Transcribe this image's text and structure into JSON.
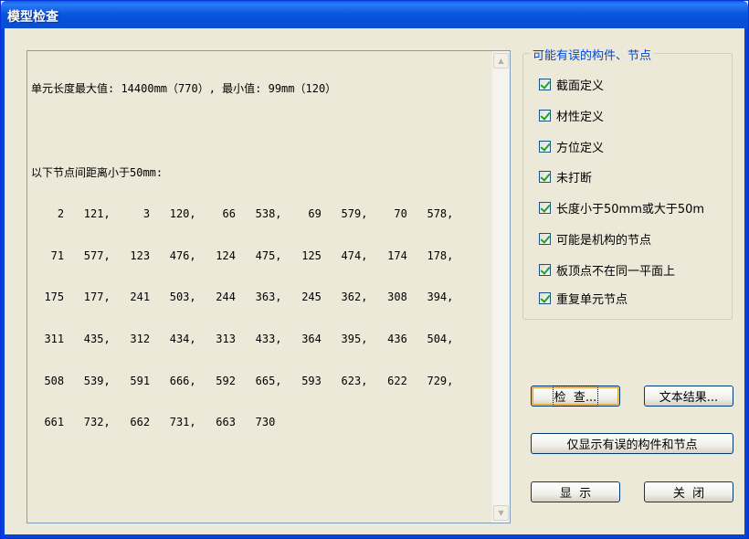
{
  "window": {
    "title": "模型检查"
  },
  "output": {
    "lines": [
      "单元长度最大值: 14400mm（770）, 最小值: 99mm（120）",
      "",
      "以下节点间距离小于50mm:",
      "    2   121,     3   120,    66   538,    69   579,    70   578,",
      "   71   577,   123   476,   124   475,   125   474,   174   178,",
      "  175   177,   241   503,   244   363,   245   362,   308   394,",
      "  311   435,   312   434,   313   433,   364   395,   436   504,",
      "  508   539,   591   666,   592   665,   593   623,   622   729,",
      "  661   732,   662   731,   663   730"
    ]
  },
  "checks": {
    "group_title": "可能有误的构件、节点",
    "items": [
      {
        "label": "截面定义",
        "checked": true
      },
      {
        "label": "材性定义",
        "checked": true
      },
      {
        "label": "方位定义",
        "checked": true
      },
      {
        "label": "未打断",
        "checked": true
      },
      {
        "label": "长度小于50mm或大于50m",
        "checked": true
      },
      {
        "label": "可能是机构的节点",
        "checked": true
      },
      {
        "label": "板顶点不在同一平面上",
        "checked": true
      },
      {
        "label": "重复单元节点",
        "checked": true
      }
    ]
  },
  "buttons": {
    "check": "检  查...",
    "text_results": "文本结果...",
    "show_errors_only": "仅显示有误的构件和节点",
    "display": "显  示",
    "close": "关  闭"
  }
}
